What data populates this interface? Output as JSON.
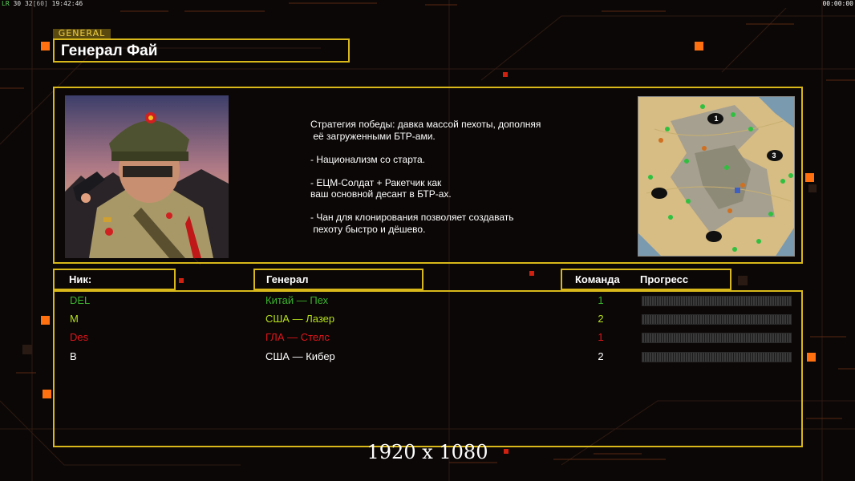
{
  "topbar": {
    "lr": "LR",
    "n1": "30",
    "n2": "32",
    "bracket": "[60]",
    "time": "19:42:46",
    "timer": "00:00:00"
  },
  "section_tag": "GENERAL",
  "general_name": "Генерал Фай",
  "description": "Стратегия победы: давка массой пехоты, дополняя\n её загруженными БТР-ами.\n\n- Национализм со старта.\n\n- ЕЦМ-Солдат + Ракетчик как\nваш основной десант в БТР-ах.\n\n- Чан для клонирования позволяет создавать\n пехоту быстро и дёшево.",
  "minimap": {
    "markers": [
      "1",
      "3"
    ]
  },
  "headers": {
    "nick": "Ник:",
    "general": "Генерал",
    "team": "Команда",
    "progress": "Прогресс"
  },
  "players": [
    {
      "nick": "DEL",
      "general": "Китай — Пех",
      "team": "1",
      "progress": 0,
      "color": "#3cb52e"
    },
    {
      "nick": "M",
      "general": "США — Лазер",
      "team": "2",
      "progress": 0,
      "color": "#b7e21b"
    },
    {
      "nick": "Des",
      "general": "ГЛА — Стелс",
      "team": "1",
      "progress": 0,
      "color": "#e0161c"
    },
    {
      "nick": "B",
      "general": "США — Кибер",
      "team": "2",
      "progress": 0,
      "color": "#ffffff"
    }
  ],
  "watermark": "1920 x 1080",
  "colors": {
    "frame": "#d8b81a",
    "accent": "#ff6a00"
  }
}
